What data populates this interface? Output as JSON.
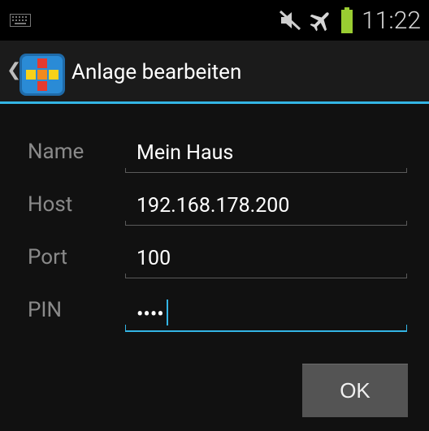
{
  "status_bar": {
    "time": "11:22",
    "icons": [
      "keyboard-icon",
      "mute-icon",
      "airplane-mode-icon",
      "battery-icon"
    ],
    "battery_color": "#9ACD32"
  },
  "action_bar": {
    "title": "Anlage bearbeiten",
    "accent_color": "#33B5E5"
  },
  "form": {
    "fields": [
      {
        "label": "Name",
        "value": "Mein Haus"
      },
      {
        "label": "Host",
        "value": "192.168.178.200"
      },
      {
        "label": "Port",
        "value": "100"
      },
      {
        "label": "PIN",
        "value": "••••"
      }
    ]
  },
  "buttons": {
    "ok_label": "OK"
  }
}
